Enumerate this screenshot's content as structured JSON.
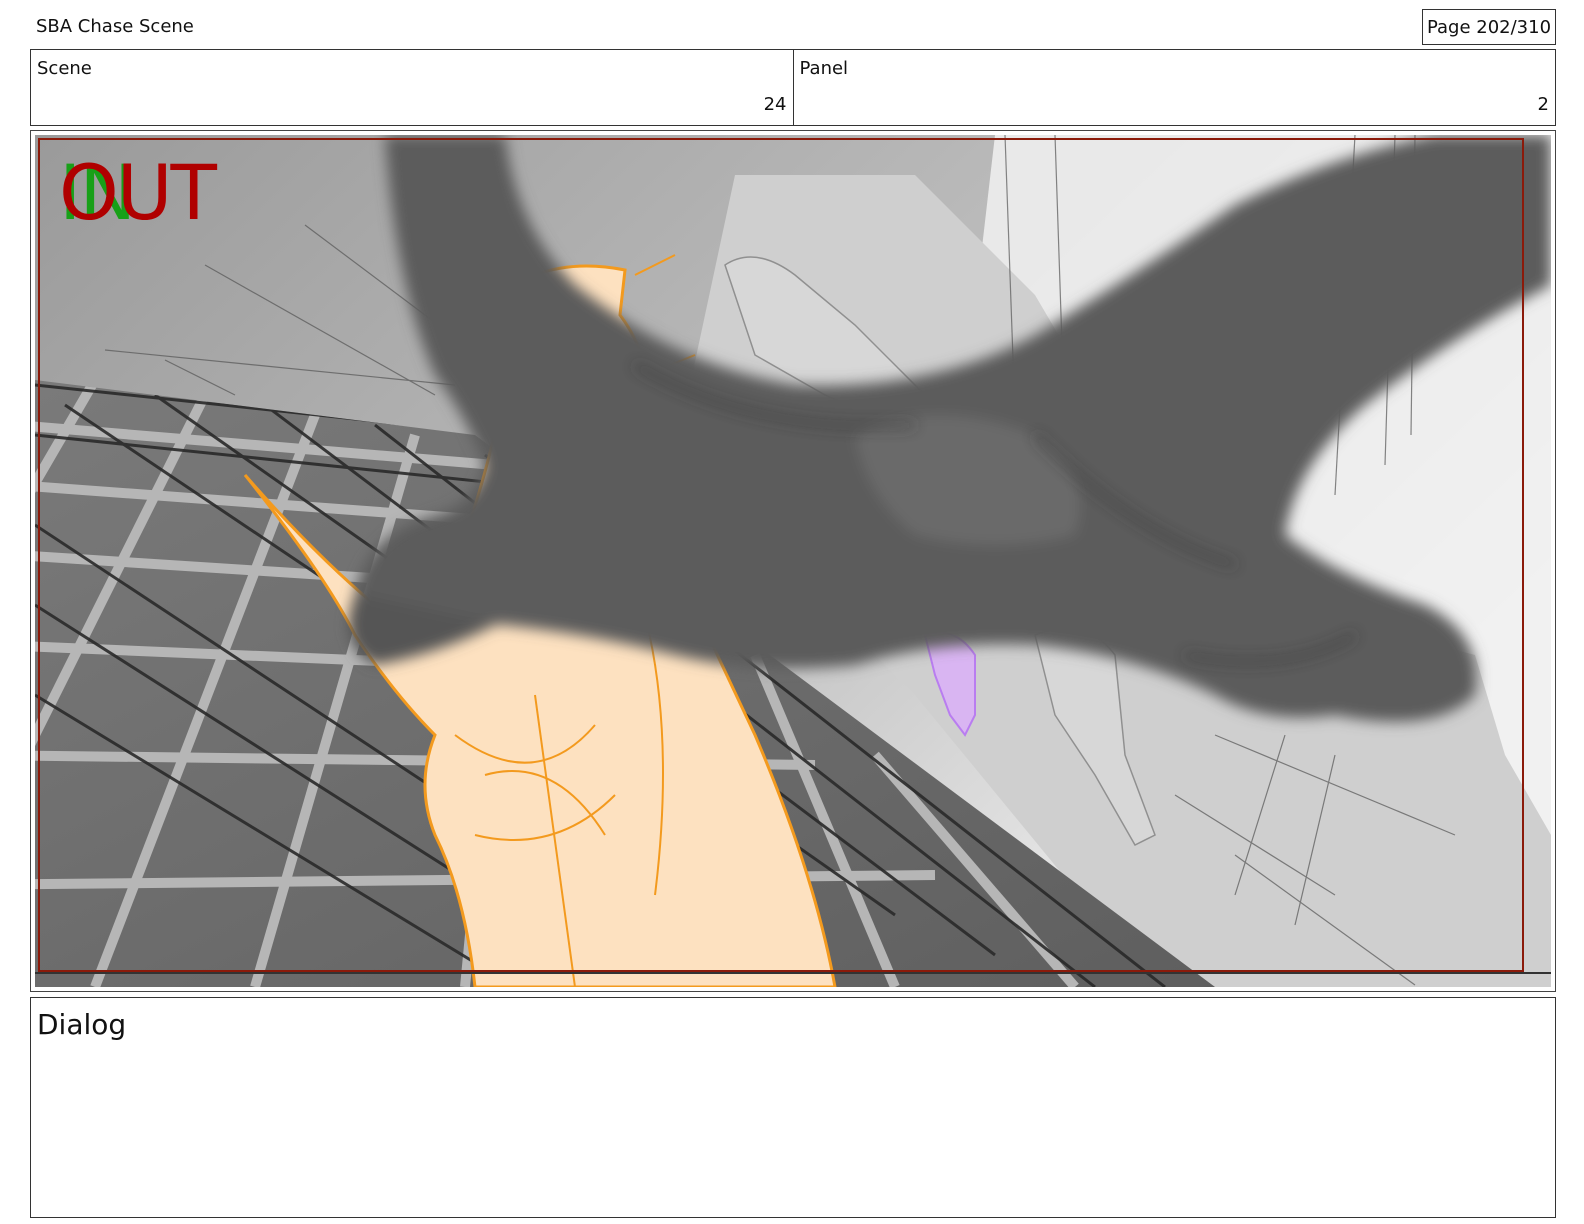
{
  "header": {
    "title": "SBA Chase Scene",
    "page": "Page 202/310"
  },
  "meta": {
    "scene_label": "Scene",
    "scene_value": "24",
    "panel_label": "Panel",
    "panel_value": "2"
  },
  "panel": {
    "in_mark": "IN",
    "out_mark": "OUT",
    "in_color": "#18a018",
    "out_color": "#b00000",
    "safe_frame_color": "#8b1a0a"
  },
  "dialog": {
    "label": "Dialog"
  }
}
